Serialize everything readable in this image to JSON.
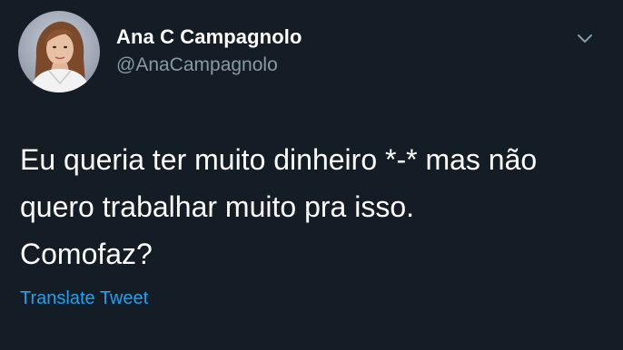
{
  "author": {
    "display_name": "Ana C Campagnolo",
    "handle": "@AnaCampagnolo"
  },
  "tweet": {
    "text": "Eu queria ter muito dinheiro *-* mas não\nquero trabalhar muito pra isso.\nComofaz?",
    "translate_label": "Translate Tweet"
  },
  "icons": {
    "menu": "chevron-down-icon",
    "avatar": "profile-photo"
  },
  "colors": {
    "background": "#141d26",
    "text": "#ffffff",
    "secondary_text": "#8899a6",
    "link": "#1da1f2"
  }
}
